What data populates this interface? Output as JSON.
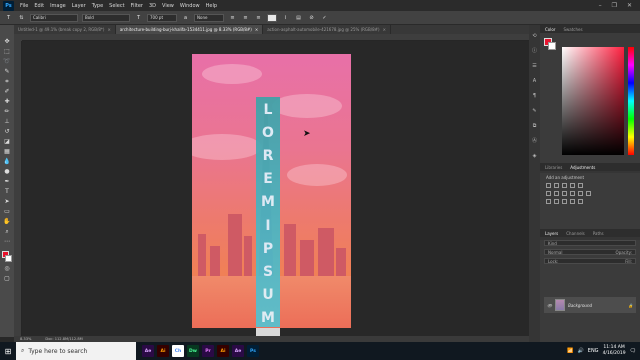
{
  "app": {
    "logo": "Ps",
    "menu": [
      "File",
      "Edit",
      "Image",
      "Layer",
      "Type",
      "Select",
      "Filter",
      "3D",
      "View",
      "Window",
      "Help"
    ],
    "window_controls": [
      "minimize-icon",
      "maximize-icon",
      "close-icon"
    ]
  },
  "options": {
    "font_family": "Calibri",
    "font_style": "Bold",
    "font_size": "700 pt",
    "antialias": "None"
  },
  "tabs": [
    {
      "label": "Untitled-1 @ 49.1% (break copy 2, RGB/8*)",
      "active": false
    },
    {
      "label": "architecture-building-burj-khalifa-1534411.jpg @ 8.33% (RGB/8#)",
      "active": true
    },
    {
      "label": "action-asphalt-automobile-421678.jpg @ 25% (RGB/8#)",
      "active": false
    }
  ],
  "canvas": {
    "text_layer": [
      "L",
      "O",
      "R",
      "E",
      "M",
      "I",
      "P",
      "S",
      "U",
      "M"
    ],
    "colors": {
      "sky_top": "#e870a8",
      "sky_bottom": "#f08056",
      "text_fill": "#47b5c2"
    }
  },
  "status": {
    "zoom": "8.33%",
    "doc": "Doc: 112.8M/112.8M"
  },
  "panels": {
    "color_tabs": [
      "Color",
      "Swatches"
    ],
    "foreground": "#e81530",
    "background": "#ffffff",
    "adj_tabs": [
      "Libraries",
      "Adjustments"
    ],
    "adj_hint": "Add an adjustment",
    "layer_tabs": [
      "Layers",
      "Channels",
      "Paths"
    ],
    "layer_kind": "Kind",
    "blend_mode": "Normal",
    "opacity_label": "Opacity:",
    "fill_label": "Fill:",
    "lock_label": "Lock:",
    "layer_name": "Background"
  },
  "taskbar": {
    "search_placeholder": "Type here to search",
    "apps": [
      {
        "label": "Ae",
        "color": "#2a0a45",
        "fg": "#d9a6ff"
      },
      {
        "label": "Ai",
        "color": "#330000",
        "fg": "#ff9a00"
      },
      {
        "label": "Ch",
        "color": "#ffffff",
        "fg": "#4285f4"
      },
      {
        "label": "Dw",
        "color": "#073820",
        "fg": "#4cff9a"
      },
      {
        "label": "Pr",
        "color": "#2a0a45",
        "fg": "#e77cff"
      },
      {
        "label": "Ai",
        "color": "#330000",
        "fg": "#ff9a00"
      },
      {
        "label": "Ae",
        "color": "#2a0a45",
        "fg": "#d9a6ff"
      },
      {
        "label": "Ps",
        "color": "#001e36",
        "fg": "#31a8ff"
      }
    ],
    "language": "ENG",
    "time": "11:14 AM",
    "date": "4/16/2019"
  }
}
